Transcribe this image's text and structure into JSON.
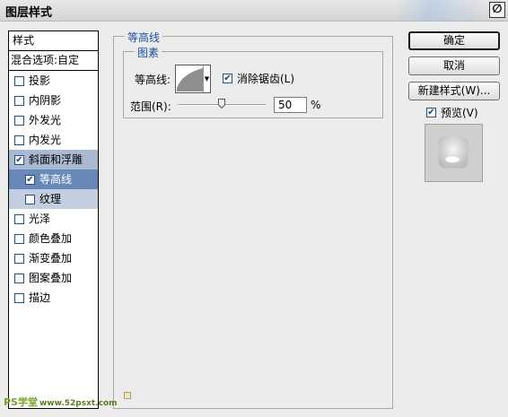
{
  "window": {
    "title": "图层样式",
    "close_glyph": "∅"
  },
  "sidebar": {
    "header": "样式",
    "blend_options": "混合选项:自定",
    "items": [
      {
        "label": "投影",
        "checked": false
      },
      {
        "label": "内阴影",
        "checked": false
      },
      {
        "label": "外发光",
        "checked": false
      },
      {
        "label": "内发光",
        "checked": false
      },
      {
        "label": "斜面和浮雕",
        "checked": true
      },
      {
        "label": "等高线",
        "checked": true
      },
      {
        "label": "纹理",
        "checked": false
      },
      {
        "label": "光泽",
        "checked": false
      },
      {
        "label": "颜色叠加",
        "checked": false
      },
      {
        "label": "渐变叠加",
        "checked": false
      },
      {
        "label": "图案叠加",
        "checked": false
      },
      {
        "label": "描边",
        "checked": false
      }
    ]
  },
  "panel": {
    "group_title": "等高线",
    "subgroup_title": "图素",
    "contour_label": "等高线:",
    "antialias_label": "消除锯齿(L)",
    "antialias_checked": true,
    "range_label": "范围(R):",
    "range_value": "50",
    "range_unit": "%"
  },
  "buttons": {
    "ok": "确定",
    "cancel": "取消",
    "new_style": "新建样式(W)...",
    "preview_label": "预览(V)",
    "preview_checked": true
  },
  "watermark": {
    "brand": "PS学堂",
    "url": "www.52psxt.com"
  },
  "colors": {
    "selected_row": "#6888ba",
    "parent_row": "#a9b9d2",
    "sub_row": "#c3cee0",
    "legend_text": "#1d4fa0"
  }
}
